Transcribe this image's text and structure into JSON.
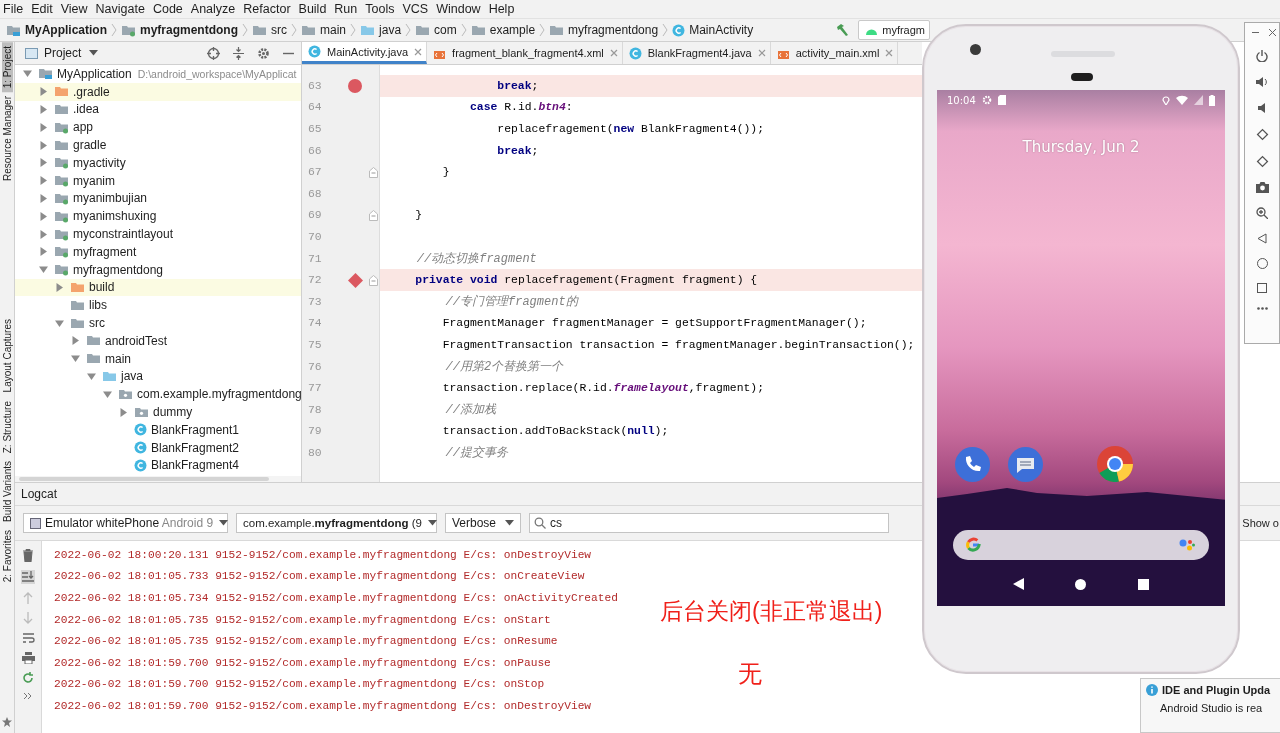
{
  "menu": [
    "File",
    "Edit",
    "View",
    "Navigate",
    "Code",
    "Analyze",
    "Refactor",
    "Build",
    "Run",
    "Tools",
    "VCS",
    "Window",
    "Help"
  ],
  "breadcrumb": [
    {
      "label": "MyApplication",
      "kind": "project"
    },
    {
      "label": "myfragmentdong",
      "kind": "module"
    },
    {
      "label": "src",
      "kind": "folder"
    },
    {
      "label": "main",
      "kind": "folder"
    },
    {
      "label": "java",
      "kind": "source"
    },
    {
      "label": "com",
      "kind": "folder"
    },
    {
      "label": "example",
      "kind": "folder"
    },
    {
      "label": "myfragmentdong",
      "kind": "folder"
    },
    {
      "label": "MainActivity",
      "kind": "class"
    }
  ],
  "run_config": "myfragm",
  "side_tools": [
    {
      "label": "1: Project",
      "selected": true
    },
    {
      "label": "Resource Manager",
      "selected": false
    },
    {
      "label": "Layout Captures",
      "selected": false
    },
    {
      "label": "Z: Structure",
      "selected": false
    },
    {
      "label": "Build Variants",
      "selected": false
    },
    {
      "label": "2: Favorites",
      "selected": false
    }
  ],
  "project_panel": {
    "title": "Project"
  },
  "project_tree": [
    {
      "label": "MyApplication",
      "kind": "project",
      "path": "D:\\android_workspace\\MyApplicat",
      "expanded": true,
      "children": [
        {
          "label": ".gradle",
          "kind": "excluded",
          "expanded": false
        },
        {
          "label": ".idea",
          "kind": "folder",
          "expanded": false
        },
        {
          "label": "app",
          "kind": "module",
          "expanded": false
        },
        {
          "label": "gradle",
          "kind": "folder",
          "expanded": false
        },
        {
          "label": "myactivity",
          "kind": "module",
          "expanded": false
        },
        {
          "label": "myanim",
          "kind": "module",
          "expanded": false
        },
        {
          "label": "myanimbujian",
          "kind": "module",
          "expanded": false
        },
        {
          "label": "myanimshuxing",
          "kind": "module",
          "expanded": false
        },
        {
          "label": "myconstraintlayout",
          "kind": "module",
          "expanded": false
        },
        {
          "label": "myfragment",
          "kind": "module",
          "expanded": false
        },
        {
          "label": "myfragmentdong",
          "kind": "module",
          "expanded": true,
          "children": [
            {
              "label": "build",
              "kind": "excluded",
              "expanded": false
            },
            {
              "label": "libs",
              "kind": "folder"
            },
            {
              "label": "src",
              "kind": "folder",
              "expanded": true,
              "children": [
                {
                  "label": "androidTest",
                  "kind": "folder",
                  "expanded": false
                },
                {
                  "label": "main",
                  "kind": "folder",
                  "expanded": true,
                  "children": [
                    {
                      "label": "java",
                      "kind": "source",
                      "expanded": true,
                      "children": [
                        {
                          "label": "com.example.myfragmentdong",
                          "kind": "package",
                          "expanded": true,
                          "children": [
                            {
                              "label": "dummy",
                              "kind": "package",
                              "expanded": false
                            },
                            {
                              "label": "BlankFragment1",
                              "kind": "class"
                            },
                            {
                              "label": "BlankFragment2",
                              "kind": "class"
                            },
                            {
                              "label": "BlankFragment4",
                              "kind": "class"
                            }
                          ]
                        }
                      ]
                    }
                  ]
                }
              ]
            }
          ]
        }
      ]
    }
  ],
  "editor_tabs": [
    {
      "label": "MainActivity.java",
      "kind": "class",
      "selected": true
    },
    {
      "label": "fragment_blank_fragment4.xml",
      "kind": "xml",
      "selected": false
    },
    {
      "label": "BlankFragment4.java",
      "kind": "class",
      "selected": false
    },
    {
      "label": "activity_main.xml",
      "kind": "xml",
      "selected": false
    }
  ],
  "code_lines": [
    {
      "number": "63",
      "kind": "line-breakpoint",
      "highlighted": true,
      "fold": false,
      "segments": [
        {
          "kind": "keyword",
          "text": "                break"
        },
        {
          "kind": "plain",
          "text": ";"
        }
      ]
    },
    {
      "number": "64",
      "kind": "plain",
      "highlighted": false,
      "fold": false,
      "segments": [
        {
          "kind": "keyword",
          "text": "            case"
        },
        {
          "kind": "plain",
          "text": " R.id."
        },
        {
          "kind": "field",
          "text": "btn4"
        },
        {
          "kind": "plain",
          "text": ":"
        }
      ]
    },
    {
      "number": "65",
      "kind": "plain",
      "highlighted": false,
      "fold": false,
      "segments": [
        {
          "kind": "plain",
          "text": "                replacefragement("
        },
        {
          "kind": "keyword",
          "text": "new"
        },
        {
          "kind": "plain",
          "text": " BlankFragment4());"
        }
      ]
    },
    {
      "number": "66",
      "kind": "plain",
      "highlighted": false,
      "fold": false,
      "segments": [
        {
          "kind": "keyword",
          "text": "                break"
        },
        {
          "kind": "plain",
          "text": ";"
        }
      ]
    },
    {
      "number": "67",
      "kind": "plain",
      "highlighted": false,
      "fold": true,
      "segments": [
        {
          "kind": "plain",
          "text": "        }"
        }
      ]
    },
    {
      "number": "68",
      "kind": "plain",
      "highlighted": false,
      "fold": false
    },
    {
      "number": "69",
      "kind": "plain",
      "highlighted": false,
      "fold": true,
      "segments": [
        {
          "kind": "plain",
          "text": "    }"
        }
      ]
    },
    {
      "number": "70",
      "kind": "plain",
      "highlighted": false,
      "fold": false
    },
    {
      "number": "71",
      "kind": "plain",
      "highlighted": false,
      "fold": false,
      "segments": [
        {
          "kind": "comment",
          "text": "    //动态切换fragment"
        }
      ]
    },
    {
      "number": "72",
      "kind": "method-breakpoint",
      "highlighted": true,
      "fold": true,
      "segments": [
        {
          "kind": "keyword",
          "text": "    private"
        },
        {
          "kind": "keyword",
          "text": " void"
        },
        {
          "kind": "plain",
          "text": " replacefragement(Fragment fragment) {"
        }
      ]
    },
    {
      "number": "73",
      "kind": "plain",
      "highlighted": false,
      "fold": false,
      "segments": [
        {
          "kind": "comment",
          "text": "        //专门管理fragment的"
        }
      ]
    },
    {
      "number": "74",
      "kind": "plain",
      "highlighted": false,
      "fold": false,
      "segments": [
        {
          "kind": "plain",
          "text": "        FragmentManager fragmentManager = getSupportFragmentManager();"
        }
      ]
    },
    {
      "number": "75",
      "kind": "plain",
      "highlighted": false,
      "fold": false,
      "segments": [
        {
          "kind": "plain",
          "text": "        FragmentTransaction transaction = fragmentManager.beginTransaction();"
        }
      ]
    },
    {
      "number": "76",
      "kind": "plain",
      "highlighted": false,
      "fold": false,
      "segments": [
        {
          "kind": "comment",
          "text": "        //用第2个替换第一个"
        }
      ]
    },
    {
      "number": "77",
      "kind": "plain",
      "highlighted": false,
      "fold": false,
      "segments": [
        {
          "kind": "plain",
          "text": "        transaction.replace(R.id."
        },
        {
          "kind": "field",
          "text": "framelayout"
        },
        {
          "kind": "plain",
          "text": ",fragment);"
        }
      ]
    },
    {
      "number": "78",
      "kind": "plain",
      "highlighted": false,
      "fold": false,
      "segments": [
        {
          "kind": "comment",
          "text": "        //添加栈"
        }
      ]
    },
    {
      "number": "79",
      "kind": "plain",
      "highlighted": false,
      "fold": false,
      "segments": [
        {
          "kind": "plain",
          "text": "        transaction.addToBackStack("
        },
        {
          "kind": "keyword",
          "text": "null"
        },
        {
          "kind": "plain",
          "text": ");"
        }
      ]
    },
    {
      "number": "80",
      "kind": "plain",
      "highlighted": false,
      "fold": false,
      "segments": [
        {
          "kind": "comment",
          "text": "        //提交事务"
        }
      ]
    }
  ],
  "logcat": {
    "title": "Logcat",
    "device": {
      "name": "Emulator whitePhone",
      "detail": "Android 9"
    },
    "process": "com.example.**myfragmentdong** (9",
    "level": "Verbose",
    "search": "cs",
    "show_option": "Show o",
    "lines": [
      "2022-06-02 18:00:20.131 9152-9152/com.example.myfragmentdong E/cs: onDestroyView",
      "2022-06-02 18:01:05.733 9152-9152/com.example.myfragmentdong E/cs: onCreateView",
      "2022-06-02 18:01:05.734 9152-9152/com.example.myfragmentdong E/cs: onActivityCreated",
      "2022-06-02 18:01:05.735 9152-9152/com.example.myfragmentdong E/cs: onStart",
      "2022-06-02 18:01:05.735 9152-9152/com.example.myfragmentdong E/cs: onResume",
      "2022-06-02 18:01:59.700 9152-9152/com.example.myfragmentdong E/cs: onPause",
      "2022-06-02 18:01:59.700 9152-9152/com.example.myfragmentdong E/cs: onStop",
      "2022-06-02 18:01:59.700 9152-9152/com.example.myfragmentdong E/cs: onDestroyView"
    ]
  },
  "annotations": [
    "后台关闭(非正常退出)",
    "无"
  ],
  "phone": {
    "time": "10:04",
    "date": "Thursday, Jun 2"
  },
  "notification": {
    "title": "IDE and Plugin Upda",
    "text": "Android Studio is rea"
  }
}
